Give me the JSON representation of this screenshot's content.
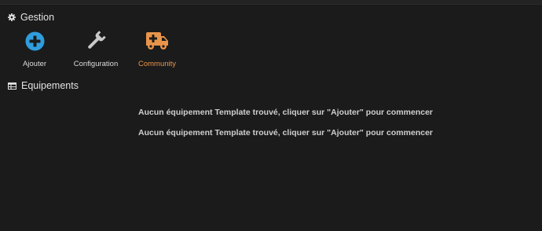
{
  "gestion": {
    "title": "Gestion",
    "icon": "gear-icon",
    "cards": [
      {
        "label": "Ajouter",
        "icon": "plus-circle-icon",
        "color": "#2f9dde"
      },
      {
        "label": "Configuration",
        "icon": "wrench-icon",
        "color": "#c9c9c9"
      },
      {
        "label": "Community",
        "icon": "ambulance-icon",
        "color": "#e8944a"
      }
    ]
  },
  "equipements": {
    "title": "Equipements",
    "icon": "table-icon",
    "empty_messages": [
      "Aucun équipement Template trouvé, cliquer sur \"Ajouter\" pour commencer",
      "Aucun équipement Template trouvé, cliquer sur \"Ajouter\" pour commencer"
    ]
  },
  "colors": {
    "background": "#1b1b1b",
    "accent_blue": "#2f9dde",
    "accent_orange": "#e8944a"
  }
}
